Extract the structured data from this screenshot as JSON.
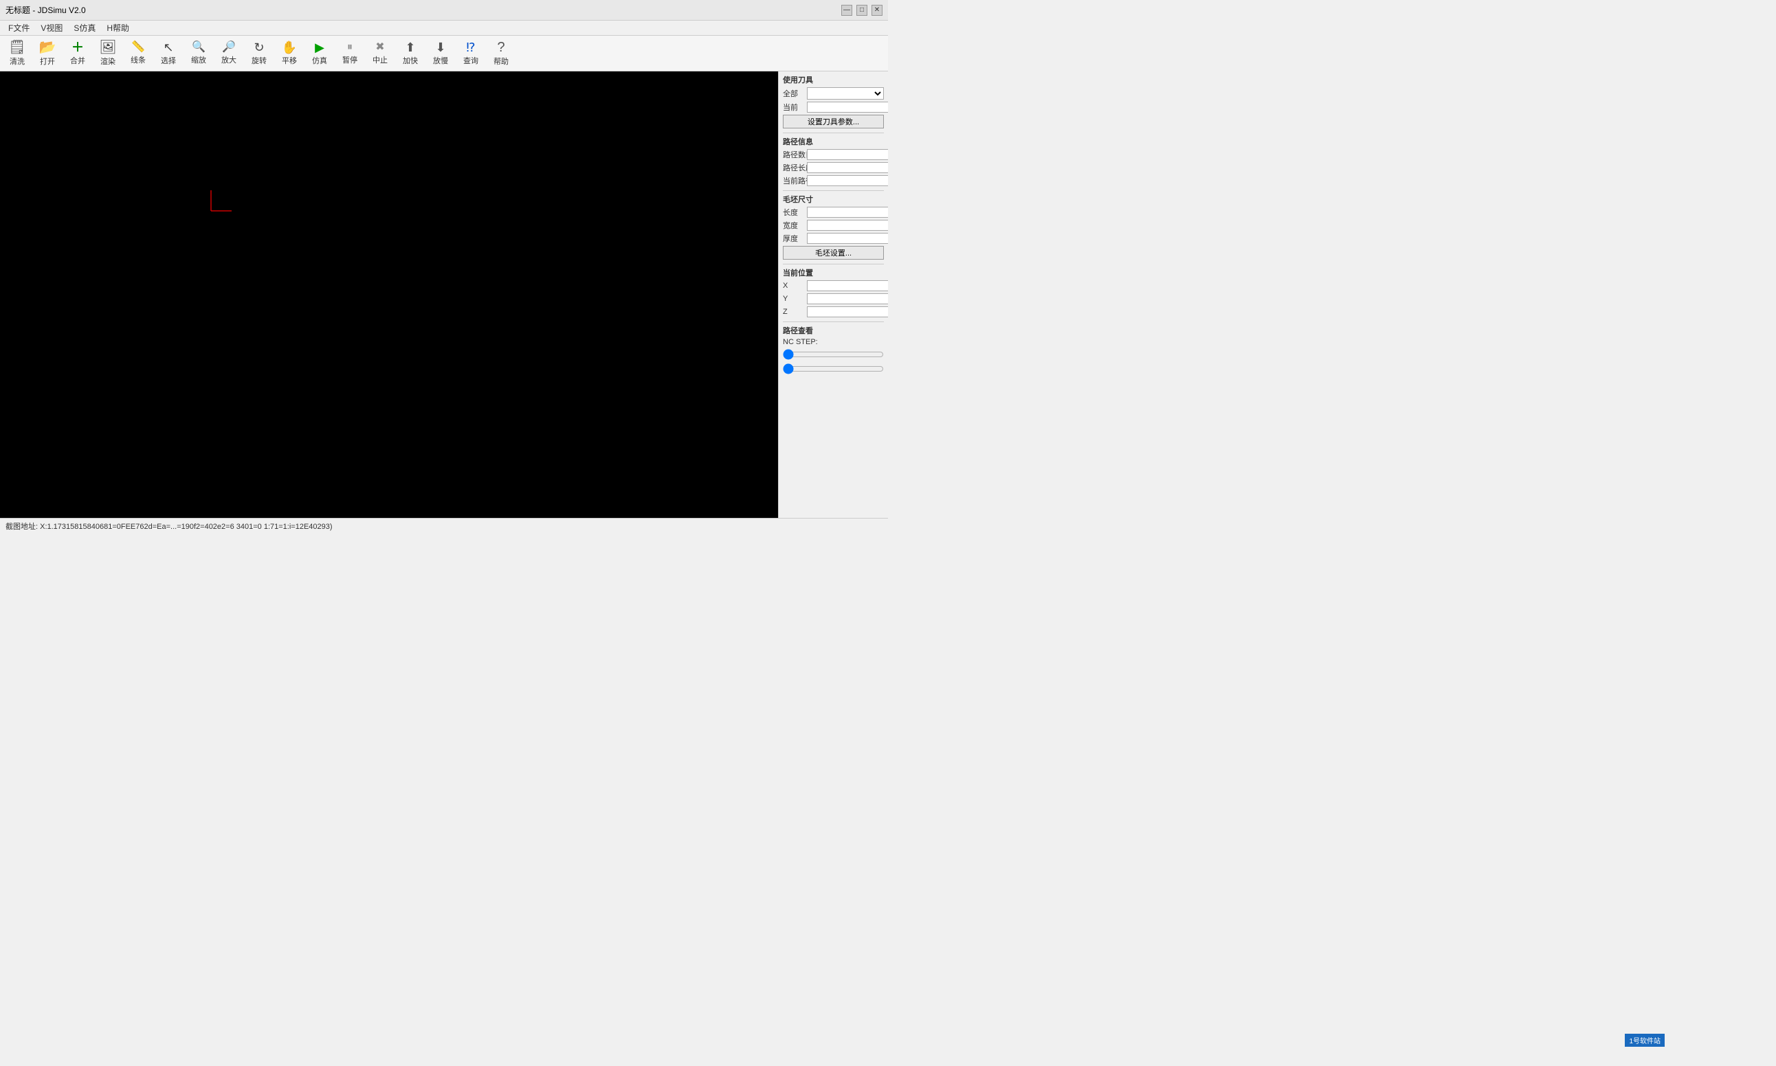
{
  "titleBar": {
    "title": "无标题 - JDSimu V2.0",
    "minimizeBtn": "—",
    "maximizeBtn": "□",
    "closeBtn": "✕"
  },
  "menuBar": {
    "items": [
      {
        "label": "F文件",
        "name": "menu-file"
      },
      {
        "label": "V视图",
        "name": "menu-view"
      },
      {
        "label": "S仿真",
        "name": "menu-simulate"
      },
      {
        "label": "H帮助",
        "name": "menu-help"
      }
    ]
  },
  "toolbar": {
    "buttons": [
      {
        "label": "清洗",
        "icon": "🗒",
        "name": "btn-clean"
      },
      {
        "label": "打开",
        "icon": "📂",
        "name": "btn-open"
      },
      {
        "label": "合并",
        "icon": "➕",
        "name": "btn-merge"
      },
      {
        "label": "渲染",
        "icon": "🖼",
        "name": "btn-render"
      },
      {
        "label": "线条",
        "icon": "📐",
        "name": "btn-lines"
      },
      {
        "label": "选择",
        "icon": "↖",
        "name": "btn-select"
      },
      {
        "label": "缩放",
        "icon": "🔍",
        "name": "btn-zoom"
      },
      {
        "label": "放大",
        "icon": "🔎",
        "name": "btn-zoomin"
      },
      {
        "label": "旋转",
        "icon": "↻",
        "name": "btn-rotate"
      },
      {
        "label": "平移",
        "icon": "✋",
        "name": "btn-pan"
      },
      {
        "label": "仿真",
        "icon": "▶",
        "name": "btn-simulate"
      },
      {
        "label": "暂停",
        "icon": "⏸",
        "name": "btn-pause"
      },
      {
        "label": "中止",
        "icon": "✖",
        "name": "btn-stop"
      },
      {
        "label": "加快",
        "icon": "⬆",
        "name": "btn-speedup"
      },
      {
        "label": "放慢",
        "icon": "⬇",
        "name": "btn-slowdown"
      },
      {
        "label": "查询",
        "icon": "❓",
        "name": "btn-query"
      },
      {
        "label": "帮助",
        "icon": "?",
        "name": "btn-help"
      }
    ]
  },
  "rightPanel": {
    "toolSection": {
      "title": "使用刀具",
      "allLabel": "全部",
      "currentLabel": "当前",
      "settingsBtn": "设置刀具参数..."
    },
    "pathInfoSection": {
      "title": "路径信息",
      "pathCountLabel": "路径数目",
      "pathLengthLabel": "路径长度",
      "currentPathLabel": "当前路径"
    },
    "blankSizeSection": {
      "title": "毛坯尺寸",
      "lengthLabel": "长度",
      "widthLabel": "宽度",
      "thicknessLabel": "厚度",
      "settingsBtn": "毛坯设置..."
    },
    "currentPositionSection": {
      "title": "当前位置",
      "xLabel": "X",
      "yLabel": "Y",
      "zLabel": "Z"
    },
    "pathViewSection": {
      "title": "路径查看",
      "ncStepLabel": "NC STEP:",
      "slider1Value": "",
      "slider2Value": ""
    }
  },
  "statusBar": {
    "text": "截图地址: X:1.17315815840681=0FEE762d=Ea=...=190f2=402e2=6 3401=0 1:71=1:i=12E40293)"
  }
}
